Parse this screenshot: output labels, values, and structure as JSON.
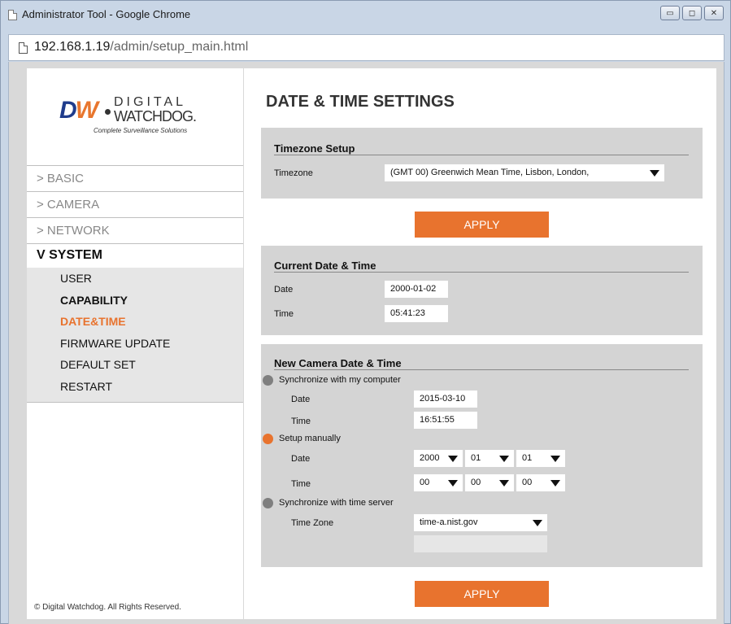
{
  "window": {
    "title": "Administrator Tool - Google Chrome",
    "buttons": {
      "minimize": "▭",
      "maximize": "◻",
      "close": "✕"
    }
  },
  "address": {
    "host": "192.168.1.19",
    "path": "/admin/setup_main.html"
  },
  "logo": {
    "mark_d": "D",
    "mark_w": "W",
    "line1": "DIGITAL",
    "line2": "WATCHDOG.",
    "tagline": "Complete Surveillance Solutions"
  },
  "sidebar": {
    "items": [
      {
        "label": "> BASIC"
      },
      {
        "label": "> CAMERA"
      },
      {
        "label": "> NETWORK"
      }
    ],
    "system_label": "V SYSTEM",
    "sub_items": [
      {
        "label": "USER"
      },
      {
        "label": "CAPABILITY"
      },
      {
        "label": "DATE&TIME"
      },
      {
        "label": "FIRMWARE UPDATE"
      },
      {
        "label": "DEFAULT SET"
      },
      {
        "label": "RESTART"
      }
    ],
    "footer": "© Digital Watchdog. All Rights Reserved."
  },
  "main": {
    "title": "DATE & TIME SETTINGS",
    "timezone_section": {
      "title": "Timezone Setup",
      "label": "Timezone",
      "value": "(GMT  00) Greenwich Mean Time, Lisbon, London,"
    },
    "apply_label": "APPLY",
    "current_section": {
      "title": "Current Date & Time",
      "date_label": "Date",
      "date_value": "2000-01-02",
      "time_label": "Time",
      "time_value": "05:41:23"
    },
    "new_section": {
      "title": "New Camera Date & Time",
      "sync_computer_label": "Synchronize with my computer",
      "sync_date_label": "Date",
      "sync_date_value": "2015-03-10",
      "sync_time_label": "Time",
      "sync_time_value": "16:51:55",
      "manual_label": "Setup manually",
      "manual_date_label": "Date",
      "manual_year": "2000",
      "manual_month": "01",
      "manual_day": "01",
      "manual_time_label": "Time",
      "manual_hour": "00",
      "manual_minute": "00",
      "manual_second": "00",
      "server_label": "Synchronize with time server",
      "server_tz_label": "Time Zone",
      "server_value": "time-a.nist.gov",
      "server_custom": ""
    }
  },
  "colors": {
    "accent": "#e8732e",
    "panel": "#d4d4d4",
    "brand_blue": "#1f3c8c"
  }
}
